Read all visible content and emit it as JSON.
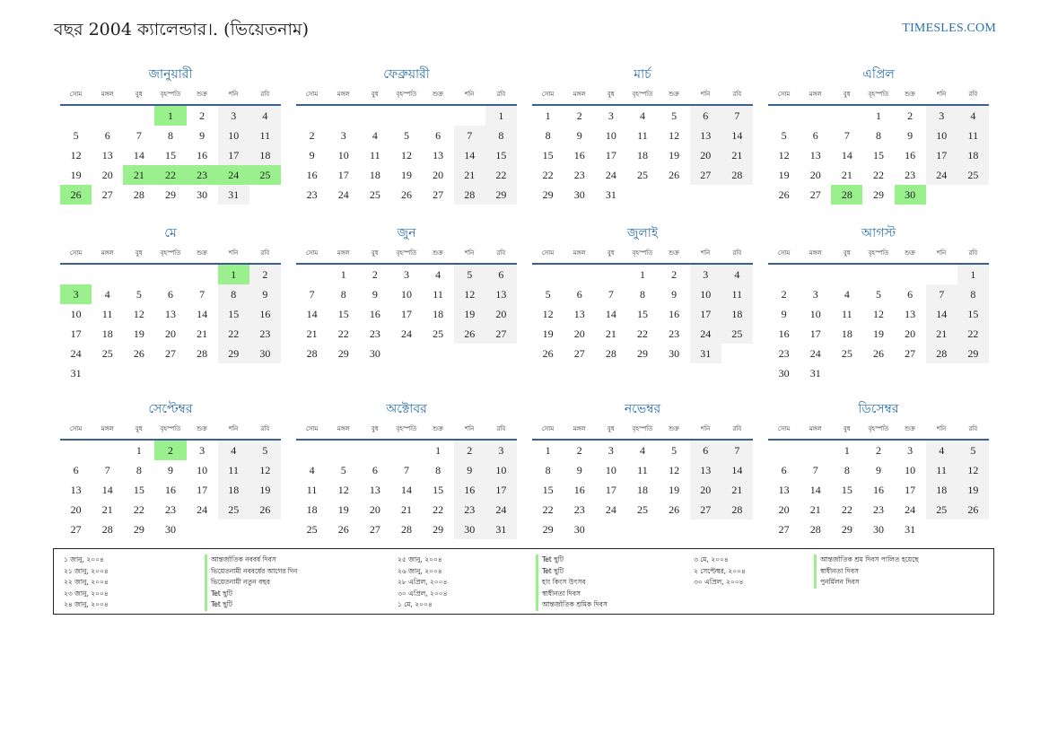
{
  "header": {
    "title": "বছর 2004 ক্যালেন্ডার।. (ভিয়েতনাম)",
    "site": "TIMESLES.COM"
  },
  "colors": {
    "accent": "#2a6fad",
    "holiday": "#9af08d",
    "weekend": "#f2f2f2",
    "rule": "#3b5f91"
  },
  "weekdays": [
    "সোম",
    "মঙ্গল",
    "বুধ",
    "বৃহস্পতি",
    "শুক্র",
    "শনি",
    "রবি"
  ],
  "months": [
    {
      "name": "জানুয়ারী",
      "offset": 3,
      "days": 31,
      "holidays": [
        1,
        21,
        22,
        23,
        24,
        25,
        26
      ]
    },
    {
      "name": "ফেব্রুয়ারী",
      "offset": 6,
      "days": 29,
      "holidays": []
    },
    {
      "name": "মার্চ",
      "offset": 0,
      "days": 31,
      "holidays": []
    },
    {
      "name": "এপ্রিল",
      "offset": 3,
      "days": 30,
      "holidays": [
        28,
        30
      ]
    },
    {
      "name": "মে",
      "offset": 5,
      "days": 31,
      "holidays": [
        1,
        3
      ]
    },
    {
      "name": "জুন",
      "offset": 1,
      "days": 30,
      "holidays": []
    },
    {
      "name": "জুলাই",
      "offset": 3,
      "days": 31,
      "holidays": []
    },
    {
      "name": "আগস্ট",
      "offset": 6,
      "days": 31,
      "holidays": []
    },
    {
      "name": "সেপ্টেম্বর",
      "offset": 2,
      "days": 30,
      "holidays": [
        2
      ]
    },
    {
      "name": "অক্টোবর",
      "offset": 4,
      "days": 31,
      "holidays": []
    },
    {
      "name": "নভেম্বর",
      "offset": 0,
      "days": 30,
      "holidays": []
    },
    {
      "name": "ডিসেম্বর",
      "offset": 2,
      "days": 31,
      "holidays": []
    }
  ],
  "holidays": [
    {
      "date": "১ জানু, ২০০৪",
      "name": "আন্তর্জাতিক নববর্ষ দিবস"
    },
    {
      "date": "২১ জানু, ২০০৪",
      "name": "ভিয়েতনামী নববর্ষের আগের দিন"
    },
    {
      "date": "২২ জানু, ২০০৪",
      "name": "ভিয়েতনামী নতুন বছর"
    },
    {
      "date": "২৩ জানু, ২০০৪",
      "name": "Tet ছুটি"
    },
    {
      "date": "২৪ জানু, ২০০৪",
      "name": "Tet ছুটি"
    },
    {
      "date": "২৫ জানু, ২০০৪",
      "name": "Tet ছুটি"
    },
    {
      "date": "২৬ জানু, ২০০৪",
      "name": "Tet ছুটি"
    },
    {
      "date": "২৮ এপ্রিল, ২০০৪",
      "name": "হাং কিংস উৎসব"
    },
    {
      "date": "৩০ এপ্রিল, ২০০৪",
      "name": "স্বাধীনতা দিবস"
    },
    {
      "date": "১ মে, ২০০৪",
      "name": "আন্তর্জাতিক শ্রমিক দিবস"
    },
    {
      "date": "৩ মে, ২০০৪",
      "name": "আন্তর্জাতিক শ্রম দিবস পালিত হয়েছে"
    },
    {
      "date": "২ সেপ্টেম্বর, ২০০৪",
      "name": "স্বাধীনতা দিবস"
    },
    {
      "date": "৩০ এপ্রিল, ২০০৪",
      "name": "পুনর্মিলন দিবস"
    }
  ]
}
